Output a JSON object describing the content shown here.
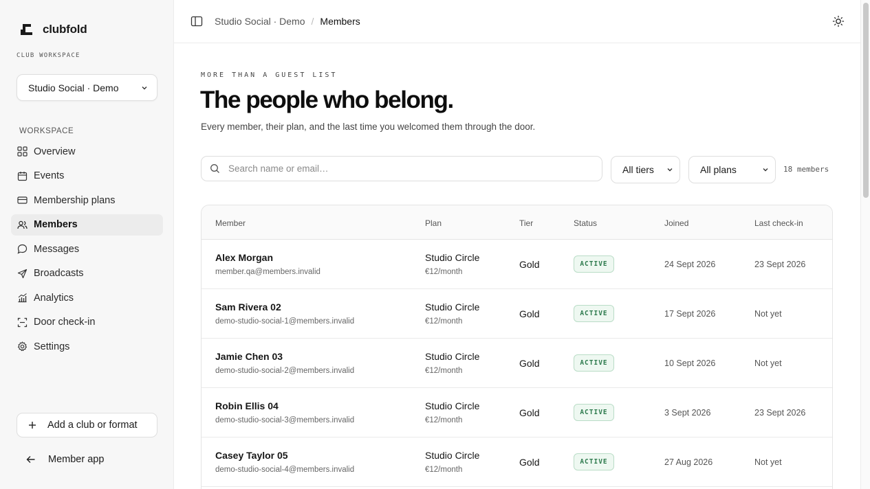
{
  "brand": {
    "name": "clubfold"
  },
  "sidebar": {
    "workspace_label": "CLUB WORKSPACE",
    "workspace_select": "Studio Social · Demo",
    "section_label": "WORKSPACE",
    "items": [
      {
        "label": "Overview",
        "icon": "grid-icon"
      },
      {
        "label": "Events",
        "icon": "calendar-icon"
      },
      {
        "label": "Membership plans",
        "icon": "card-icon"
      },
      {
        "label": "Members",
        "icon": "users-icon",
        "active": true
      },
      {
        "label": "Messages",
        "icon": "message-icon"
      },
      {
        "label": "Broadcasts",
        "icon": "send-icon"
      },
      {
        "label": "Analytics",
        "icon": "chart-icon"
      },
      {
        "label": "Door check-in",
        "icon": "scan-icon"
      },
      {
        "label": "Settings",
        "icon": "gear-icon"
      }
    ],
    "add_club": "Add a club or format",
    "member_app": "Member app"
  },
  "header": {
    "breadcrumb_parent": "Studio Social · Demo",
    "breadcrumb_separator": "/",
    "breadcrumb_current": "Members"
  },
  "main": {
    "eyebrow": "MORE THAN A GUEST LIST",
    "title": "The people who belong.",
    "subtitle": "Every member, their plan, and the last time you welcomed them through the door.",
    "search_placeholder": "Search name or email…",
    "tier_filter": "All tiers",
    "plan_filter": "All plans",
    "member_count": "18 members"
  },
  "table": {
    "columns": [
      "Member",
      "Plan",
      "Tier",
      "Status",
      "Joined",
      "Last check-in"
    ],
    "rows": [
      {
        "name": "Alex Morgan",
        "email": "member.qa@members.invalid",
        "plan": "Studio Circle",
        "price": "€12/month",
        "tier": "Gold",
        "status": "ACTIVE",
        "joined": "24 Sept 2026",
        "last_checkin": "23 Sept 2026"
      },
      {
        "name": "Sam Rivera 02",
        "email": "demo-studio-social-1@members.invalid",
        "plan": "Studio Circle",
        "price": "€12/month",
        "tier": "Gold",
        "status": "ACTIVE",
        "joined": "17 Sept 2026",
        "last_checkin": "Not yet"
      },
      {
        "name": "Jamie Chen 03",
        "email": "demo-studio-social-2@members.invalid",
        "plan": "Studio Circle",
        "price": "€12/month",
        "tier": "Gold",
        "status": "ACTIVE",
        "joined": "10 Sept 2026",
        "last_checkin": "Not yet"
      },
      {
        "name": "Robin Ellis 04",
        "email": "demo-studio-social-3@members.invalid",
        "plan": "Studio Circle",
        "price": "€12/month",
        "tier": "Gold",
        "status": "ACTIVE",
        "joined": "3 Sept 2026",
        "last_checkin": "23 Sept 2026"
      },
      {
        "name": "Casey Taylor 05",
        "email": "demo-studio-social-4@members.invalid",
        "plan": "Studio Circle",
        "price": "€12/month",
        "tier": "Gold",
        "status": "ACTIVE",
        "joined": "27 Aug 2026",
        "last_checkin": "Not yet"
      }
    ]
  },
  "colors": {
    "accent_status_text": "#2d7a4d",
    "accent_status_bg": "#eef8f1",
    "sidebar_bg": "#f7f7f7"
  }
}
